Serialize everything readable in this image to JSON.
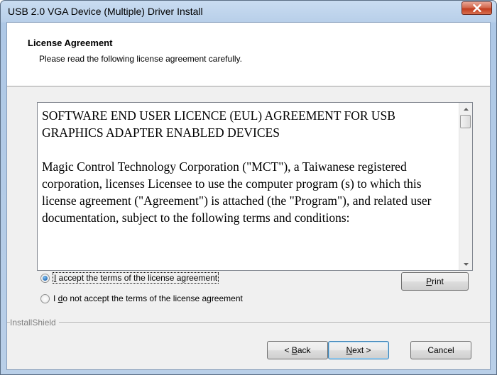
{
  "window": {
    "title": "USB 2.0 VGA Device (Multiple) Driver Install"
  },
  "header": {
    "title": "License Agreement",
    "subtitle": "Please read the following license agreement carefully."
  },
  "license": {
    "heading": "SOFTWARE END USER LICENCE (EUL) AGREEMENT FOR USB GRAPHICS ADAPTER ENABLED DEVICES",
    "body": "Magic Control Technology Corporation (\"MCT\"), a Taiwanese registered corporation, licenses Licensee to use the computer program (s) to which this license agreement (\"Agreement\") is attached (the \"Program\"), and related user documentation, subject to the following terms and conditions:"
  },
  "options": {
    "accept": {
      "prefix": "",
      "accel": "I",
      "rest": " accept the terms of the license agreement",
      "selected": true
    },
    "decline": {
      "prefix": "I ",
      "accel": "d",
      "rest": "o not accept the terms of the license agreement",
      "selected": false
    }
  },
  "footer": {
    "brand": "InstallShield"
  },
  "buttons": {
    "print": {
      "accel": "P",
      "rest": "rint"
    },
    "back": {
      "prefix": "< ",
      "accel": "B",
      "rest": "ack"
    },
    "next": {
      "prefix": "",
      "accel": "N",
      "rest": "ext >"
    },
    "cancel": {
      "label": "Cancel"
    }
  },
  "colors": {
    "close_button": "#c23d1f",
    "default_button_border": "#3c7fb1"
  }
}
